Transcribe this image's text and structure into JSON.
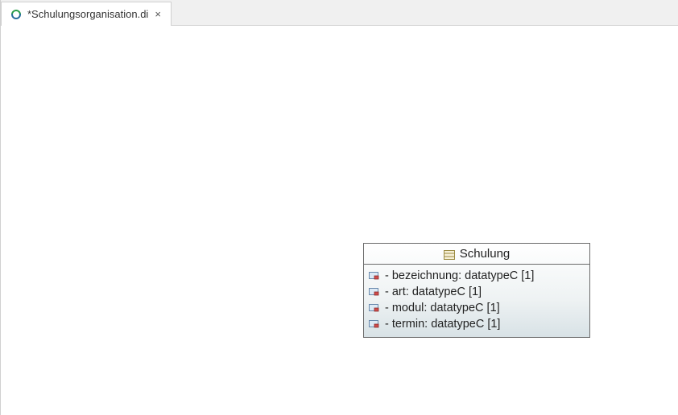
{
  "tab": {
    "label": "*Schulungsorganisation.di"
  },
  "umlClass": {
    "name": "Schulung",
    "attributes": [
      {
        "text": "- bezeichnung: datatypeC [1]"
      },
      {
        "text": "- art: datatypeC [1]"
      },
      {
        "text": "- modul: datatypeC [1]"
      },
      {
        "text": "- termin: datatypeC [1]"
      }
    ]
  }
}
